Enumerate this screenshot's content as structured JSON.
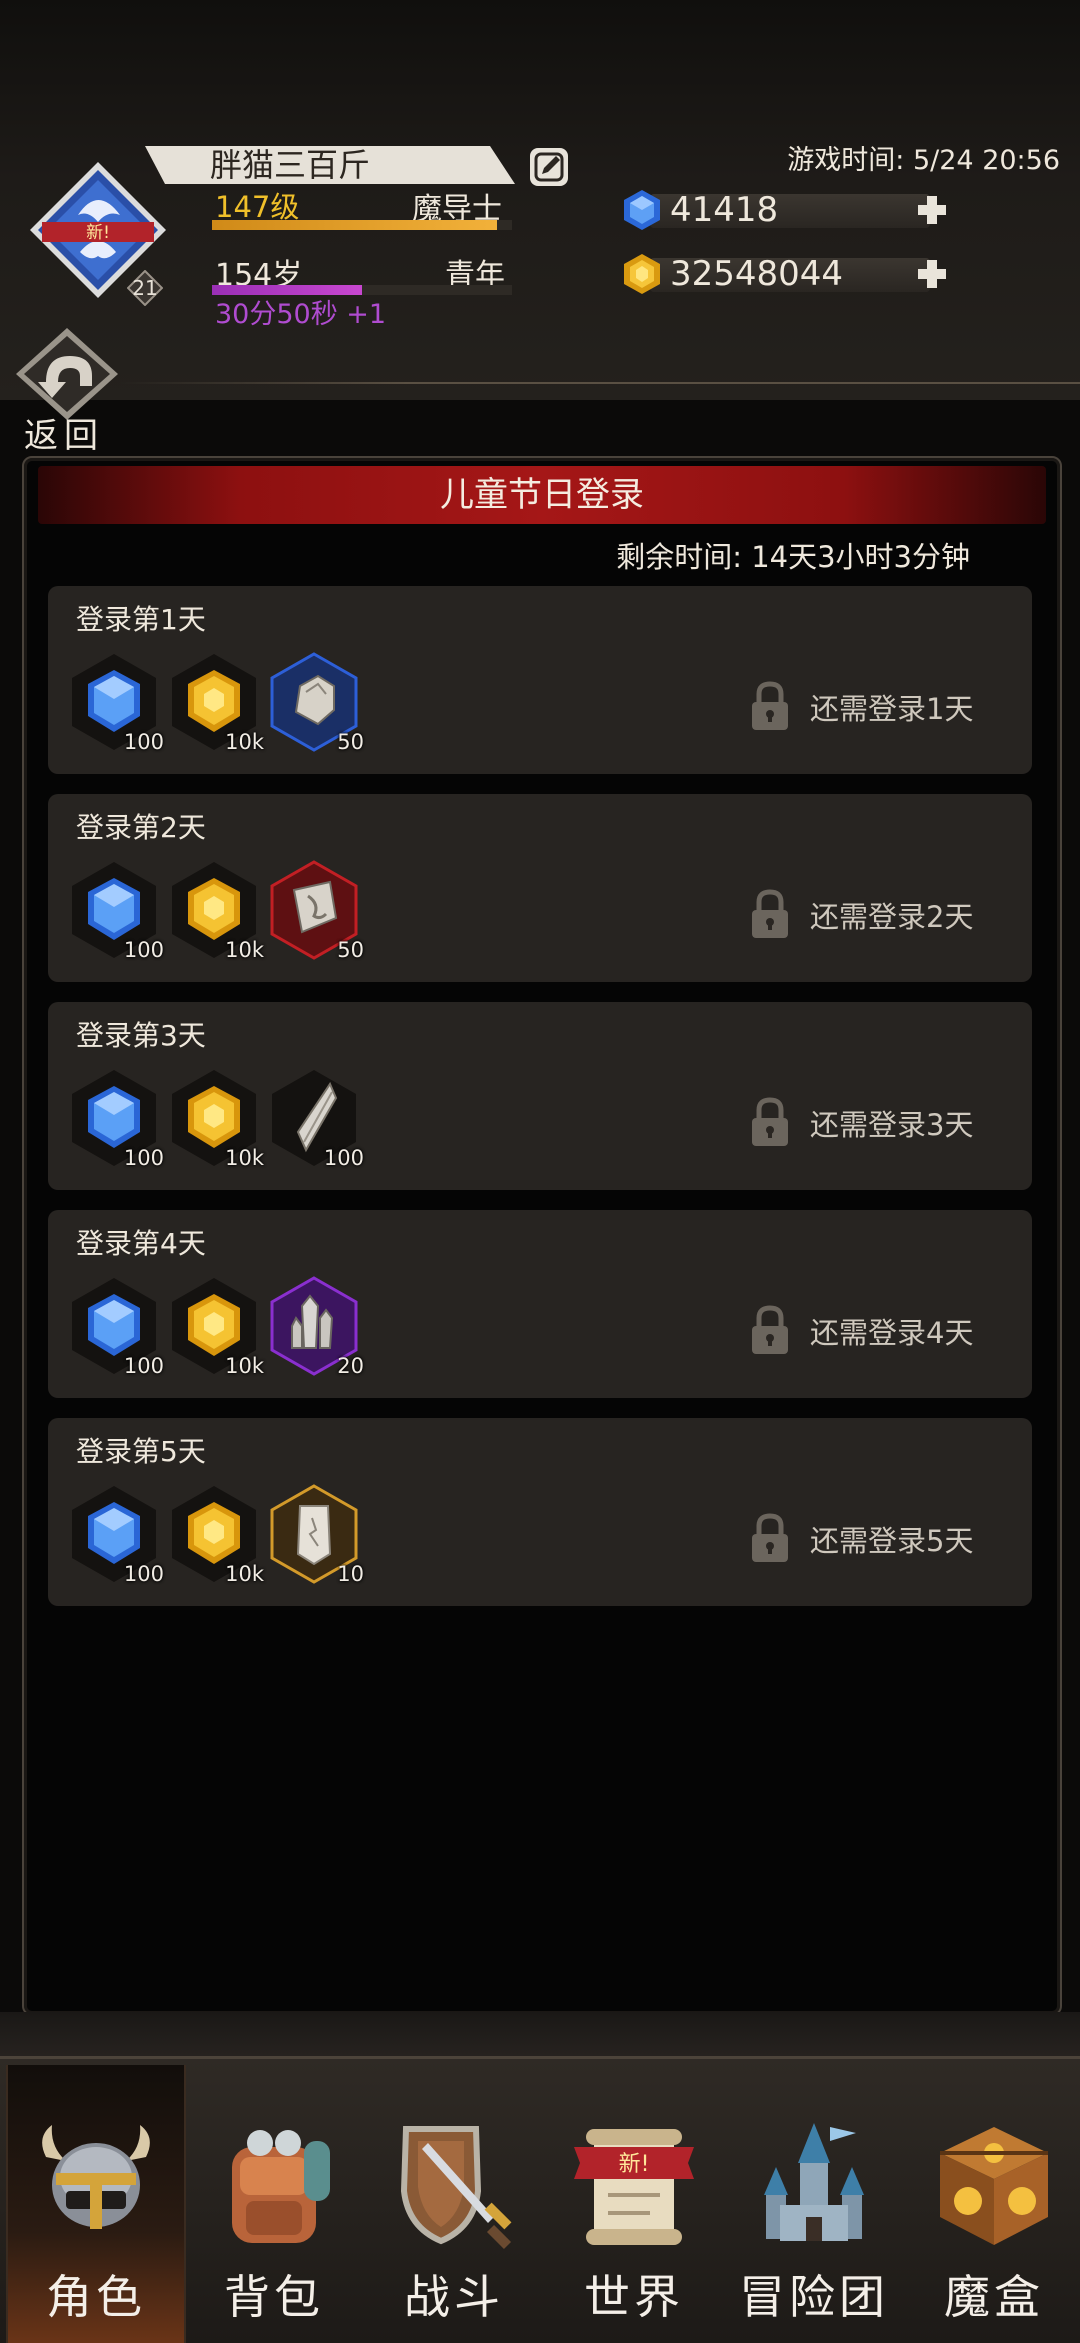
{
  "profile": {
    "name": "胖猫三百斤",
    "level": "147级",
    "class": "魔导士",
    "age": "154岁",
    "life_stage": "青年",
    "age_timer": "30分50秒 +1",
    "avatar_badge": "新!",
    "avatar_level": "21",
    "exp_fraction": 0.95,
    "age_fraction": 0.5
  },
  "game_time": "游戏时间: 5/24 20:56",
  "currencies": [
    {
      "name": "diamond",
      "value": "41418",
      "color": "#3a7be0"
    },
    {
      "name": "gold",
      "value": "32548044",
      "color": "#f0b826"
    }
  ],
  "back": {
    "label": "返回"
  },
  "event": {
    "title": "儿童节日登录",
    "remaining": "剩余时间: 14天3小时3分钟",
    "days": [
      {
        "title": "登录第1天",
        "lock_text": "还需登录1天",
        "rewards": [
          {
            "icon": "blue-gem-icon",
            "qty": "100"
          },
          {
            "icon": "gold-gem-icon",
            "qty": "10k"
          },
          {
            "icon": "stone-ore-icon",
            "qty": "50",
            "frame": "blue"
          }
        ]
      },
      {
        "title": "登录第2天",
        "lock_text": "还需登录2天",
        "rewards": [
          {
            "icon": "blue-gem-icon",
            "qty": "100"
          },
          {
            "icon": "gold-gem-icon",
            "qty": "10k"
          },
          {
            "icon": "rune-stone-icon",
            "qty": "50",
            "frame": "red"
          }
        ]
      },
      {
        "title": "登录第3天",
        "lock_text": "还需登录3天",
        "rewards": [
          {
            "icon": "blue-gem-icon",
            "qty": "100"
          },
          {
            "icon": "gold-gem-icon",
            "qty": "10k"
          },
          {
            "icon": "crystal-shard-icon",
            "qty": "100",
            "frame": "none"
          }
        ]
      },
      {
        "title": "登录第4天",
        "lock_text": "还需登录4天",
        "rewards": [
          {
            "icon": "blue-gem-icon",
            "qty": "100"
          },
          {
            "icon": "gold-gem-icon",
            "qty": "10k"
          },
          {
            "icon": "quartz-cluster-icon",
            "qty": "20",
            "frame": "purple"
          }
        ]
      },
      {
        "title": "登录第5天",
        "lock_text": "还需登录5天",
        "rewards": [
          {
            "icon": "blue-gem-icon",
            "qty": "100"
          },
          {
            "icon": "gold-gem-icon",
            "qty": "10k"
          },
          {
            "icon": "rune-tablet-icon",
            "qty": "10",
            "frame": "gold"
          }
        ]
      }
    ]
  },
  "nav": {
    "items": [
      {
        "label": "角色",
        "icon": "helmet-icon",
        "active": true
      },
      {
        "label": "背包",
        "icon": "backpack-icon"
      },
      {
        "label": "战斗",
        "icon": "sword-shield-icon"
      },
      {
        "label": "世界",
        "icon": "scroll-map-icon",
        "badge": "新!"
      },
      {
        "label": "冒险团",
        "icon": "castle-icon"
      },
      {
        "label": "魔盒",
        "icon": "magic-box-icon"
      }
    ]
  }
}
